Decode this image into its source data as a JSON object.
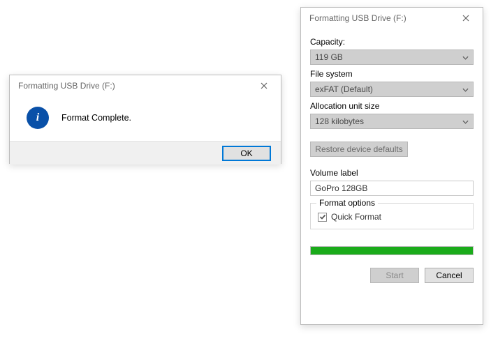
{
  "messageBox": {
    "title": "Formatting USB Drive (F:)",
    "icon": "info",
    "message": "Format Complete.",
    "ok_label": "OK"
  },
  "formatDialog": {
    "title": "Formatting USB Drive (F:)",
    "capacity": {
      "label": "Capacity:",
      "value": "119 GB"
    },
    "filesystem": {
      "label": "File system",
      "value": "exFAT (Default)"
    },
    "alloc": {
      "label": "Allocation unit size",
      "value": "128 kilobytes"
    },
    "restore_label": "Restore device defaults",
    "volume": {
      "label": "Volume label",
      "value": "GoPro 128GB"
    },
    "options": {
      "group_label": "Format options",
      "quick_format_label": "Quick Format",
      "quick_format_checked": true
    },
    "progress_percent": 100,
    "start_label": "Start",
    "cancel_label": "Cancel"
  }
}
